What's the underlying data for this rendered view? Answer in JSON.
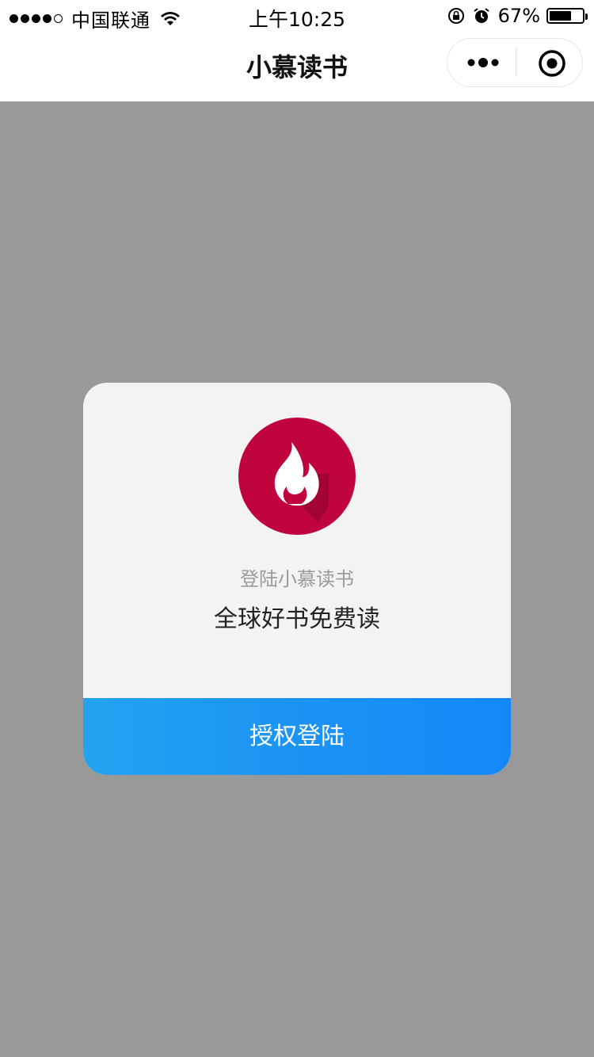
{
  "status_bar": {
    "carrier": "中国联通",
    "time": "上午10:25",
    "battery_percent": "67%",
    "battery_level": 0.67,
    "icons": [
      "signal-icon",
      "wifi-icon",
      "orientation-lock-icon",
      "alarm-icon",
      "battery-icon"
    ]
  },
  "nav_bar": {
    "title": "小慕读书",
    "icons": [
      "more-icon",
      "close-target-icon"
    ]
  },
  "dialog": {
    "logo_icon": "flame-icon",
    "logo_color": "#c0043e",
    "subtitle": "登陆小慕读书",
    "headline": "全球好书免费读",
    "button_label": "授权登陆",
    "button_color": "#1b92f4"
  },
  "colors": {
    "overlay": "#999999",
    "dialog_bg": "#f3f3f3"
  }
}
